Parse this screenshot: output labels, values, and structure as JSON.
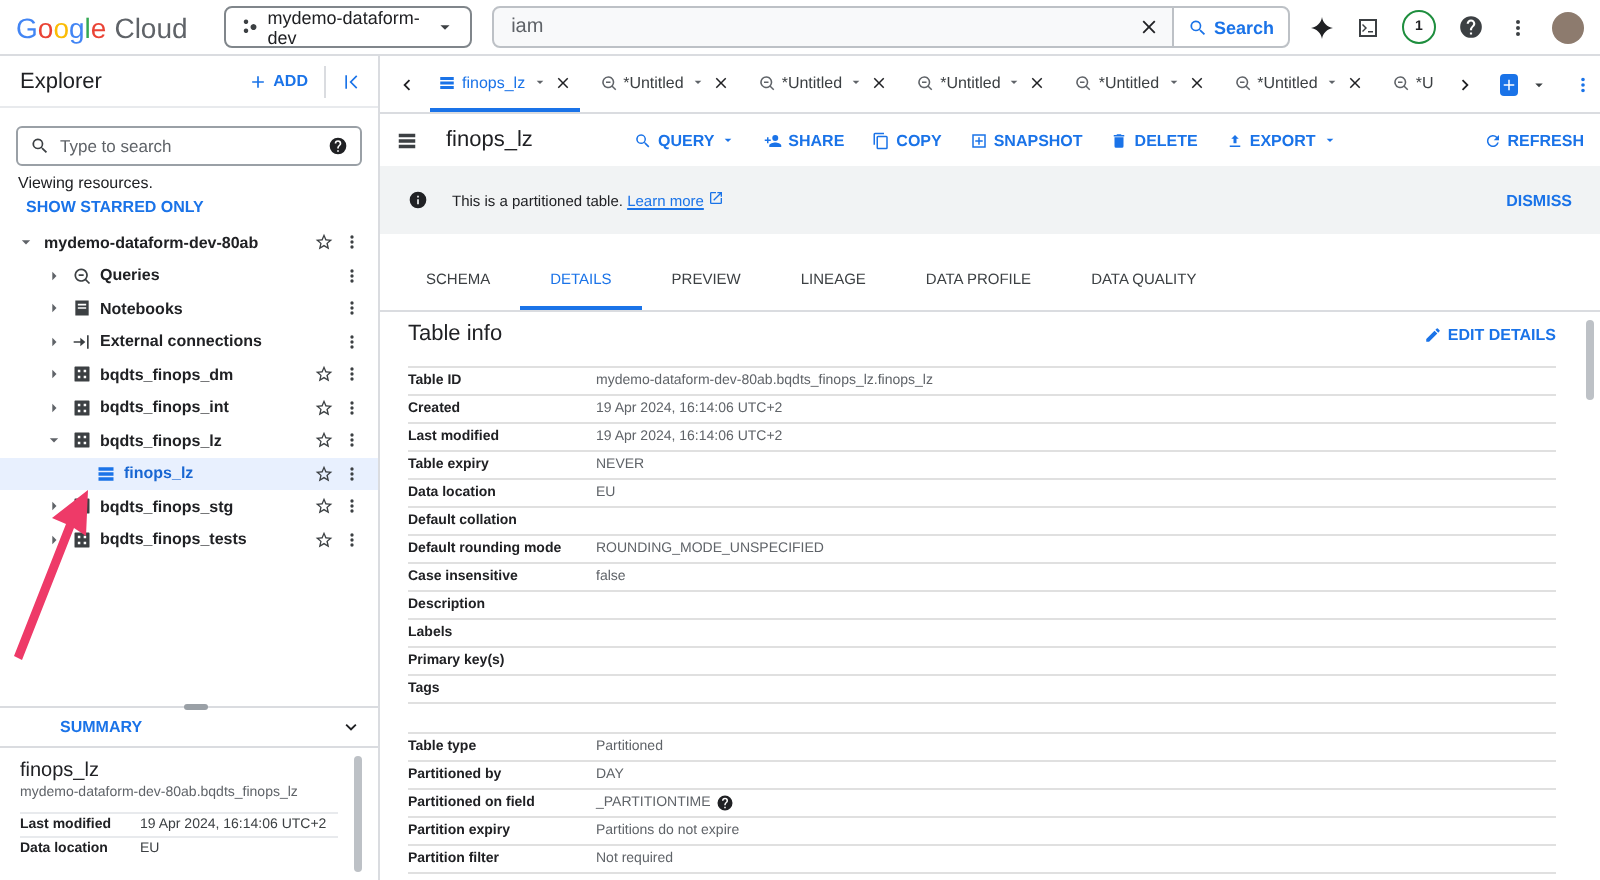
{
  "header": {
    "logo": {
      "word": "Google",
      "product": "Cloud"
    },
    "project_selector": {
      "label": "mydemo-dataform-dev"
    },
    "search": {
      "value": "iam",
      "button": "Search"
    },
    "notifications": "1"
  },
  "explorer": {
    "title": "Explorer",
    "add": "ADD",
    "search": {
      "placeholder": "Type to search"
    },
    "note": "Viewing resources.",
    "starred_link": "SHOW STARRED ONLY",
    "tree": [
      {
        "label": "mydemo-dataform-dev-80ab",
        "kind": "project",
        "expanded": true,
        "selected": false,
        "children": [
          {
            "label": "Queries",
            "kind": "queries",
            "expanded": false,
            "selected": false
          },
          {
            "label": "Notebooks",
            "kind": "notebooks",
            "expanded": false,
            "selected": false
          },
          {
            "label": "External connections",
            "kind": "connections",
            "expanded": false,
            "selected": false
          },
          {
            "label": "bqdts_finops_dm",
            "kind": "dataset",
            "expanded": false,
            "selected": false
          },
          {
            "label": "bqdts_finops_int",
            "kind": "dataset",
            "expanded": false,
            "selected": false
          },
          {
            "label": "bqdts_finops_lz",
            "kind": "dataset",
            "expanded": true,
            "selected": false,
            "children": [
              {
                "label": "finops_lz",
                "kind": "table",
                "selected": true
              }
            ]
          },
          {
            "label": "bqdts_finops_stg",
            "kind": "dataset",
            "expanded": false,
            "selected": false
          },
          {
            "label": "bqdts_finops_tests",
            "kind": "dataset",
            "expanded": false,
            "selected": false
          }
        ]
      }
    ],
    "summary": {
      "heading": "SUMMARY",
      "title": "finops_lz",
      "path": "mydemo-dataform-dev-80ab.bqdts_finops_lz",
      "rows": [
        {
          "label": "Last modified",
          "value": "19 Apr 2024, 16:14:06 UTC+2"
        },
        {
          "label": "Data location",
          "value": "EU"
        }
      ]
    }
  },
  "editor_tabs": [
    {
      "label": "finops_lz",
      "kind": "table",
      "selected": true
    },
    {
      "label": "*Untitled",
      "kind": "query",
      "selected": false
    },
    {
      "label": "*Untitled",
      "kind": "query",
      "selected": false
    },
    {
      "label": "*Untitled",
      "kind": "query",
      "selected": false
    },
    {
      "label": "*Untitled",
      "kind": "query",
      "selected": false
    },
    {
      "label": "*Untitled",
      "kind": "query",
      "selected": false
    },
    {
      "label": "*U",
      "kind": "query",
      "selected": false,
      "cut": true
    }
  ],
  "toolbar": {
    "title": "finops_lz",
    "actions": [
      {
        "label": "QUERY",
        "kind": "query",
        "menu": true
      },
      {
        "label": "SHARE",
        "kind": "share",
        "menu": false
      },
      {
        "label": "COPY",
        "kind": "copy",
        "menu": false
      },
      {
        "label": "SNAPSHOT",
        "kind": "snapshot",
        "menu": false
      },
      {
        "label": "DELETE",
        "kind": "delete",
        "menu": false
      },
      {
        "label": "EXPORT",
        "kind": "export",
        "menu": true
      }
    ],
    "refresh": "REFRESH"
  },
  "banner": {
    "text": "This is a partitioned table.",
    "link": "Learn more",
    "dismiss": "DISMISS"
  },
  "detail_tabs": [
    {
      "label": "SCHEMA",
      "selected": false
    },
    {
      "label": "DETAILS",
      "selected": true
    },
    {
      "label": "PREVIEW",
      "selected": false
    },
    {
      "label": "LINEAGE",
      "selected": false
    },
    {
      "label": "DATA PROFILE",
      "selected": false
    },
    {
      "label": "DATA QUALITY",
      "selected": false
    }
  ],
  "table_info": {
    "title": "Table info",
    "edit": "EDIT DETAILS",
    "sections": [
      [
        {
          "label": "Table ID",
          "value": "mydemo-dataform-dev-80ab.bqdts_finops_lz.finops_lz"
        },
        {
          "label": "Created",
          "value": "19 Apr 2024, 16:14:06 UTC+2"
        },
        {
          "label": "Last modified",
          "value": "19 Apr 2024, 16:14:06 UTC+2"
        },
        {
          "label": "Table expiry",
          "value": "NEVER"
        },
        {
          "label": "Data location",
          "value": "EU"
        },
        {
          "label": "Default collation"
        },
        {
          "label": "Default rounding mode",
          "value": "ROUNDING_MODE_UNSPECIFIED"
        },
        {
          "label": "Case insensitive",
          "value": "false"
        },
        {
          "label": "Description"
        },
        {
          "label": "Labels"
        },
        {
          "label": "Primary key(s)"
        },
        {
          "label": "Tags"
        }
      ],
      [
        {
          "label": "Table type",
          "value": "Partitioned"
        },
        {
          "label": "Partitioned by",
          "value": "DAY"
        },
        {
          "label": "Partitioned on field",
          "value": "_PARTITIONTIME",
          "help": true
        },
        {
          "label": "Partition expiry",
          "value": "Partitions do not expire"
        },
        {
          "label": "Partition filter",
          "value": "Not required"
        }
      ]
    ]
  }
}
